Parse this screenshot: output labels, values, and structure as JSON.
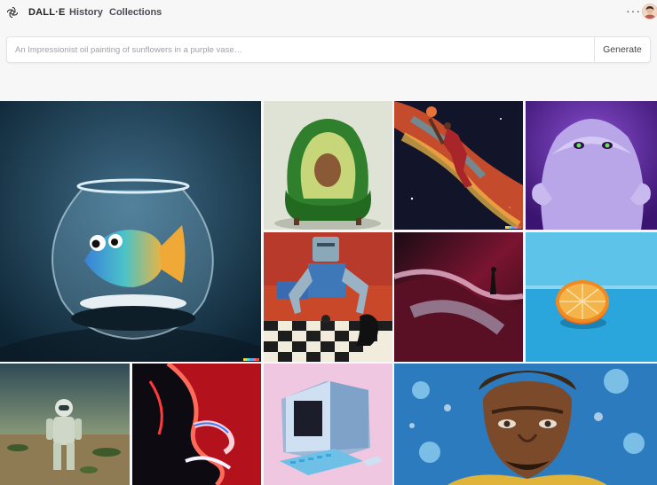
{
  "nav": {
    "brand": "DALL·E",
    "links": [
      "History",
      "Collections"
    ],
    "more": "···"
  },
  "prompt": {
    "placeholder": "An Impressionist oil painting of sunflowers in a purple vase…",
    "button": "Generate"
  },
  "gallery": {
    "tiles": [
      "fishbowl-fish",
      "avocado-armchair",
      "space-dunk",
      "purple-monster",
      "robot-chess",
      "dunes-figure",
      "orange-half",
      "desert-astronaut",
      "neon-face",
      "retro-computer",
      "painted-portrait"
    ],
    "badge_colors": [
      "#f5d547",
      "#5be0c8",
      "#53a7f5",
      "#f06fb7",
      "#e9563b"
    ]
  }
}
